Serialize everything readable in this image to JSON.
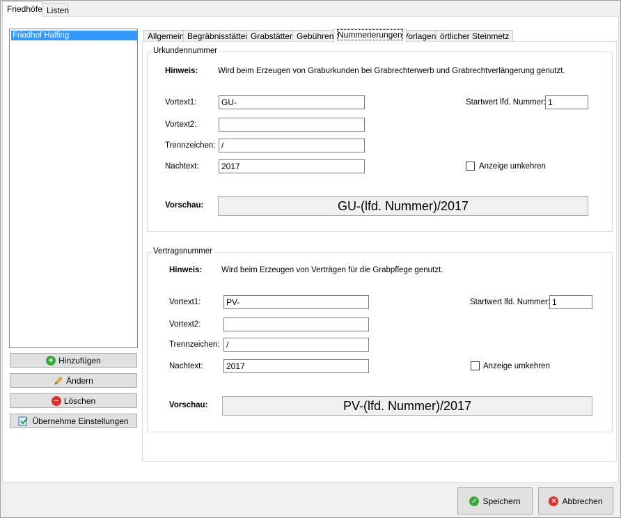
{
  "outer_tabs": [
    {
      "label": "Friedhöfe",
      "active": true
    },
    {
      "label": "Listen",
      "active": false
    }
  ],
  "cemetery_list": {
    "items": [
      "Friedhof Halfing"
    ],
    "selected": "Friedhof Halfing"
  },
  "side_buttons": {
    "add": {
      "label": "Hinzufügen",
      "icon": "plus-icon"
    },
    "edit": {
      "label": "Ändern",
      "icon": "pencil-icon"
    },
    "delete": {
      "label": "Löschen",
      "icon": "minus-icon"
    },
    "apply": {
      "label": "Übernehme Einstellungen",
      "icon": "apply-settings-icon"
    }
  },
  "inner_tabs": [
    {
      "label": "Allgemein"
    },
    {
      "label": "Begräbnisstätten"
    },
    {
      "label": "Grabstätten"
    },
    {
      "label": "Gebühren"
    },
    {
      "label": "Nummerierungen",
      "active": true
    },
    {
      "label": "Vorlagen"
    },
    {
      "label": "örtlicher Steinmetz"
    }
  ],
  "urkunde": {
    "title": "Urkundennummer",
    "hint_label": "Hinweis:",
    "hint_text": "Wird beim Erzeugen von Graburkunden bei Grabrechterwerb und Grabrechtverlängerung genutzt.",
    "vortext1_label": "Vortext1:",
    "vortext1_value": "GU-",
    "vortext2_label": "Vortext2:",
    "vortext2_value": "",
    "trenn_label": "Trennzeichen:",
    "trenn_value": "/",
    "nachtext_label": "Nachtext:",
    "nachtext_value": "2017",
    "startwert_label": "Startwert lfd. Nummer:",
    "startwert_value": "1",
    "reverse_label": "Anzeige umkehren",
    "reverse_checked": false,
    "preview_label": "Vorschau:",
    "preview_value": "GU-(lfd. Nummer)/2017"
  },
  "vertrag": {
    "title": "Vertragsnummer",
    "hint_label": "Hinweis:",
    "hint_text": "Wird beim Erzeugen von Verträgen für die Grabpflege genutzt.",
    "vortext1_label": "Vortext1:",
    "vortext1_value": "PV-",
    "vortext2_label": "Vortext2:",
    "vortext2_value": "",
    "trenn_label": "Trennzeichen:",
    "trenn_value": "/",
    "nachtext_label": "Nachtext:",
    "nachtext_value": "2017",
    "startwert_label": "Startwert lfd. Nummer:",
    "startwert_value": "1",
    "reverse_label": "Anzeige umkehren",
    "reverse_checked": false,
    "preview_label": "Vorschau:",
    "preview_value": "PV-(lfd. Nummer)/2017"
  },
  "footer": {
    "save": {
      "label": "Speichern",
      "icon": "check-icon"
    },
    "cancel": {
      "label": "Abbrechen",
      "icon": "cancel-icon"
    }
  },
  "colors": {
    "selection": "#3399ff",
    "ok_green": "#3aa83a",
    "cancel_red": "#d9322b",
    "add_green": "#3aa83a"
  }
}
